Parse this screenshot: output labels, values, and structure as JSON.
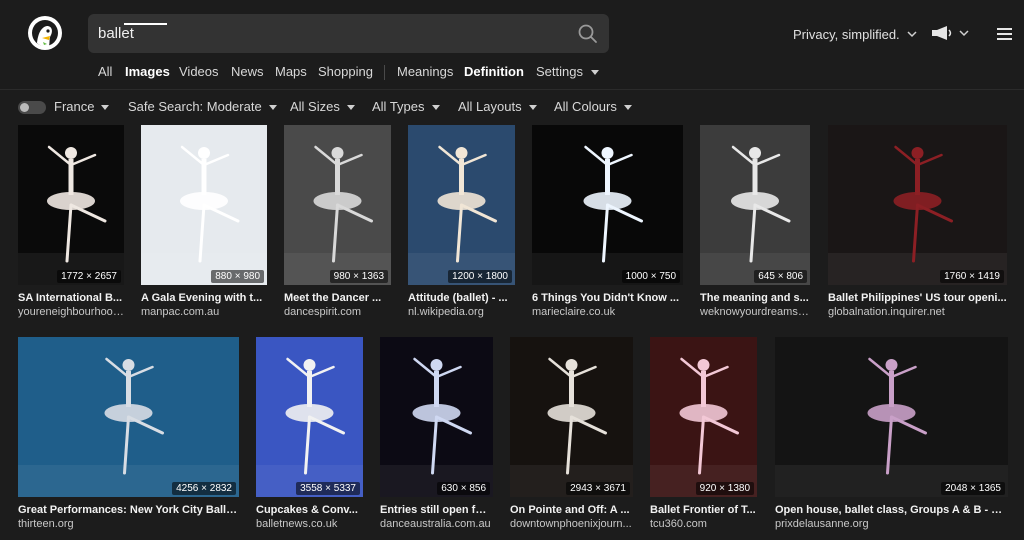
{
  "search": {
    "query": "ballet"
  },
  "header": {
    "privacy_label": "Privacy, simplified."
  },
  "tabs": [
    "All",
    "Images",
    "Videos",
    "News",
    "Maps",
    "Shopping",
    "Meanings",
    "Definition",
    "Settings"
  ],
  "filters": {
    "region": "France",
    "safe_search": "Safe Search: Moderate",
    "sizes": "All Sizes",
    "types": "All Types",
    "layouts": "All Layouts",
    "colours": "All Colours"
  },
  "results": [
    {
      "title": "SA International B...",
      "source": "youreneighbourhood...",
      "dims": "1772 × 2657",
      "bg": "#0a0a0a",
      "fg": "#efe8e2"
    },
    {
      "title": "A Gala Evening with t...",
      "source": "manpac.com.au",
      "dims": "880 × 980",
      "bg": "#e6eaee",
      "fg": "#ffffff"
    },
    {
      "title": "Meet the Dancer ...",
      "source": "dancespirit.com",
      "dims": "980 × 1363",
      "bg": "#4a4a4a",
      "fg": "#d9d9d9"
    },
    {
      "title": "Attitude (ballet) - ...",
      "source": "nl.wikipedia.org",
      "dims": "1200 × 1800",
      "bg": "#2b4a6e",
      "fg": "#f1e6d6"
    },
    {
      "title": "6 Things You Didn't Know ...",
      "source": "marieclaire.co.uk",
      "dims": "1000 × 750",
      "bg": "#080808",
      "fg": "#eef6ff"
    },
    {
      "title": "The meaning and s...",
      "source": "weknowyourdreams....",
      "dims": "645 × 806",
      "bg": "#3c3c3c",
      "fg": "#e8e8e8"
    },
    {
      "title": "Ballet Philippines' US tour openi...",
      "source": "globalnation.inquirer.net",
      "dims": "1760 × 1419",
      "bg": "#1a1616",
      "fg": "#8c1f24"
    },
    {
      "title": "Great Performances: New York City Balle...",
      "source": "thirteen.org",
      "dims": "4256 × 2832",
      "bg": "#1f5e8a",
      "fg": "#d8dde4"
    },
    {
      "title": "Cupcakes & Conv...",
      "source": "balletnews.co.uk",
      "dims": "3558 × 5337",
      "bg": "#3a56c2",
      "fg": "#f2f2f2"
    },
    {
      "title": "Entries still open for...",
      "source": "danceaustralia.com.au",
      "dims": "630 × 856",
      "bg": "#0c0a14",
      "fg": "#cfd8f2"
    },
    {
      "title": "On Pointe and Off: A ...",
      "source": "downtownphoenixjourn...",
      "dims": "2943 × 3671",
      "bg": "#16120f",
      "fg": "#e6e1da"
    },
    {
      "title": "Ballet Frontier of T...",
      "source": "tcu360.com",
      "dims": "920 × 1380",
      "bg": "#3b1414",
      "fg": "#f3c8d6"
    },
    {
      "title": "Open house, ballet class, Groups A & B - Pri...",
      "source": "prixdelausanne.org",
      "dims": "2048 × 1365",
      "bg": "#141414",
      "fg": "#c9a0c8"
    }
  ]
}
